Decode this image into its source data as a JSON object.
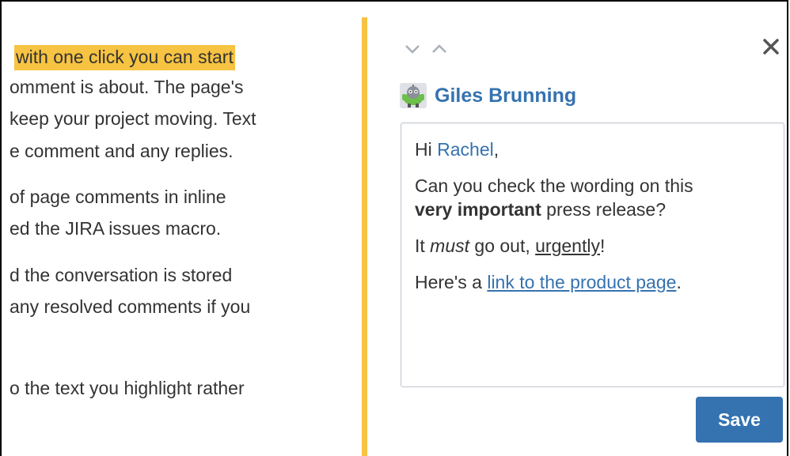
{
  "page_text": {
    "lines": [
      "with one click you can start",
      "omment is about. The page's",
      "keep your project moving. Text",
      "e comment and any replies.",
      "of page comments in inline",
      "ed the JIRA issues macro.",
      "d the conversation is stored",
      "any resolved comments if you",
      "o the text you highlight rather"
    ]
  },
  "comment": {
    "author": "Giles Brunning",
    "greeting_prefix": "Hi ",
    "mention": "Rachel",
    "greeting_suffix": ",",
    "line2_prefix": "Can you check the wording on this",
    "line2_bold": "very important",
    "line2_suffix": " press release?",
    "line3_prefix": "It ",
    "line3_italic": "must",
    "line3_middle": " go out, ",
    "line3_underline": "urgently",
    "line3_suffix": "!",
    "line4_prefix": "Here's a ",
    "line4_link": "link to the product page",
    "line4_suffix": "."
  },
  "buttons": {
    "save_label": "Save"
  },
  "icons": {
    "prev": "chevron-down-icon",
    "next": "chevron-up-icon",
    "close": "close-icon",
    "avatar": "robot-avatar-icon"
  },
  "colors": {
    "highlight": "#f6c342",
    "accent": "#3572b0",
    "text": "#333333"
  }
}
